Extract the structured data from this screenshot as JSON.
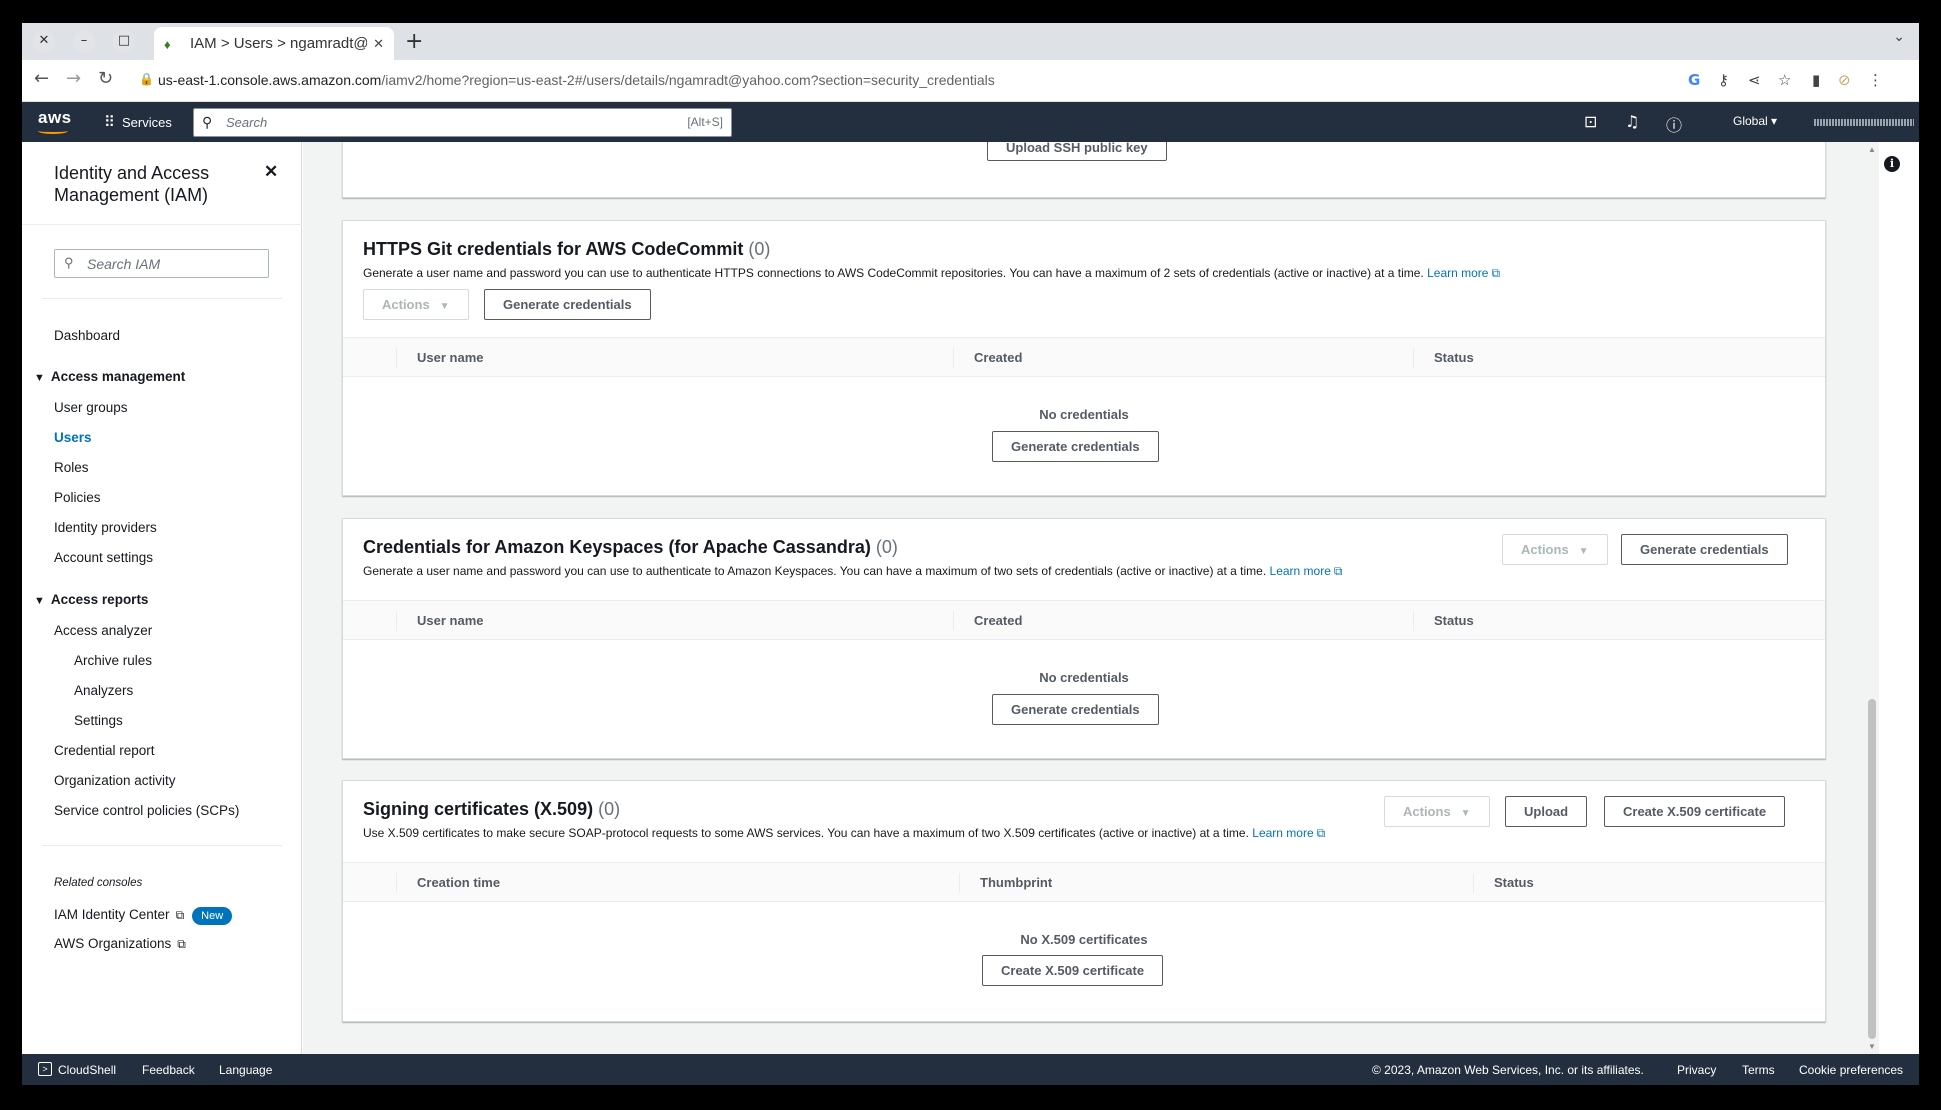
{
  "browser": {
    "tab_title": "IAM > Users > ngamradt@",
    "url_host": "us-east-1.console.aws.amazon.com",
    "url_path": "/iamv2/home?region=us-east-2#/users/details/ngamradt@yahoo.com?section=security_credentials"
  },
  "awsnav": {
    "logo": "aws",
    "services": "Services",
    "search_placeholder": "Search",
    "search_shortcut": "[Alt+S]",
    "region": "Global"
  },
  "sidebar": {
    "title": "Identity and Access Management (IAM)",
    "search_placeholder": "Search IAM",
    "dashboard": "Dashboard",
    "access_management": "Access management",
    "user_groups": "User groups",
    "users": "Users",
    "roles": "Roles",
    "policies": "Policies",
    "identity_providers": "Identity providers",
    "account_settings": "Account settings",
    "access_reports": "Access reports",
    "access_analyzer": "Access analyzer",
    "archive_rules": "Archive rules",
    "analyzers": "Analyzers",
    "settings": "Settings",
    "credential_report": "Credential report",
    "organization_activity": "Organization activity",
    "scps": "Service control policies (SCPs)",
    "related_consoles": "Related consoles",
    "iam_identity_center": "IAM Identity Center",
    "new_badge": "New",
    "aws_organizations": "AWS Organizations"
  },
  "ssh": {
    "upload_button": "Upload SSH public key"
  },
  "https_git": {
    "title": "HTTPS Git credentials for AWS CodeCommit",
    "count": "(0)",
    "description": "Generate a user name and password you can use to authenticate HTTPS connections to AWS CodeCommit repositories. You can have a maximum of 2 sets of credentials (active or inactive) at a time.",
    "learn_more": "Learn more",
    "actions": "Actions",
    "generate": "Generate credentials",
    "columns": [
      "User name",
      "Created",
      "Status"
    ],
    "empty_text": "No credentials",
    "empty_button": "Generate credentials"
  },
  "keyspaces": {
    "title": "Credentials for Amazon Keyspaces (for Apache Cassandra)",
    "count": "(0)",
    "description": "Generate a user name and password you can use to authenticate to Amazon Keyspaces. You can have a maximum of two sets of credentials (active or inactive) at a time.",
    "learn_more": "Learn more",
    "actions": "Actions",
    "generate": "Generate credentials",
    "columns": [
      "User name",
      "Created",
      "Status"
    ],
    "empty_text": "No credentials",
    "empty_button": "Generate credentials"
  },
  "x509": {
    "title": "Signing certificates (X.509)",
    "count": "(0)",
    "description": "Use X.509 certificates to make secure SOAP-protocol requests to some AWS services. You can have a maximum of two X.509 certificates (active or inactive) at a time.",
    "learn_more": "Learn more",
    "actions": "Actions",
    "upload": "Upload",
    "create": "Create X.509 certificate",
    "columns": [
      "Creation time",
      "Thumbprint",
      "Status"
    ],
    "empty_text": "No X.509 certificates",
    "empty_button": "Create X.509 certificate"
  },
  "footer": {
    "cloudshell": "CloudShell",
    "feedback": "Feedback",
    "language": "Language",
    "copyright": "© 2023, Amazon Web Services, Inc. or its affiliates.",
    "privacy": "Privacy",
    "terms": "Terms",
    "cookies": "Cookie preferences"
  }
}
